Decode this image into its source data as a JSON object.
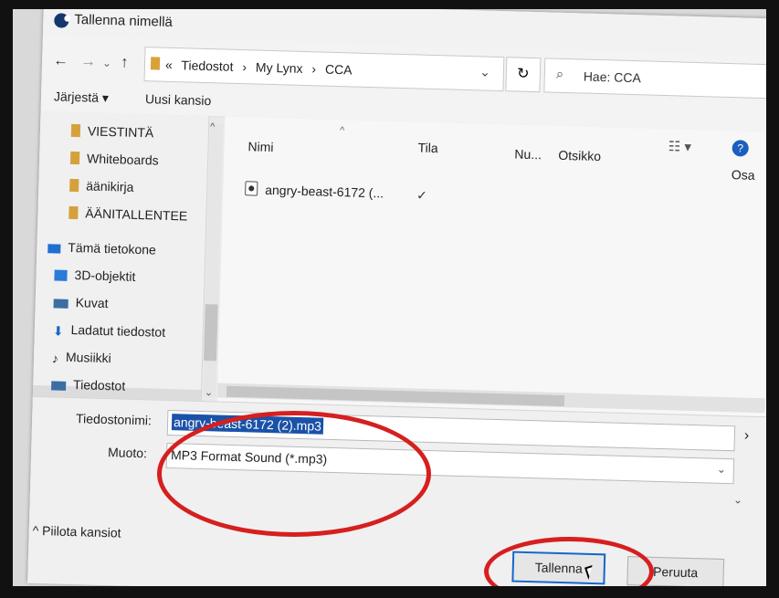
{
  "window": {
    "title": "Tallenna nimellä",
    "close": "✕"
  },
  "nav": {
    "back": "←",
    "forward": "→",
    "dropdown": "⌄",
    "up": "↑",
    "breadcrumb": [
      "«",
      "Tiedostot",
      "›",
      "My Lynx",
      "›",
      "CCA"
    ],
    "address_dropdown": "⌄",
    "refresh": "↻",
    "search_icon": "⌕",
    "search_placeholder": "Hae: CCA"
  },
  "toolbar": {
    "organize": "Järjestä ▾",
    "new_folder": "Uusi kansio"
  },
  "sidebar": {
    "items": [
      {
        "label": "VIESTINTÄ",
        "icon": "folder-icon"
      },
      {
        "label": "Whiteboards",
        "icon": "folder-icon"
      },
      {
        "label": "äänikirja",
        "icon": "folder-icon"
      },
      {
        "label": "ÄÄNITALLENTEE",
        "icon": "folder-icon"
      },
      {
        "label": "Tämä tietokone",
        "icon": "computer-icon"
      },
      {
        "label": "3D-objektit",
        "icon": "3d-objects-icon"
      },
      {
        "label": "Kuvat",
        "icon": "pictures-icon"
      },
      {
        "label": "Ladatut tiedostot",
        "icon": "download-icon"
      },
      {
        "label": "Musiikki",
        "icon": "music-icon"
      },
      {
        "label": "Tiedostot",
        "icon": "drive-icon"
      }
    ],
    "collapse_caret": "^",
    "expand_caret": "⌄"
  },
  "file_list": {
    "columns": [
      "Nimi",
      "Tila",
      "Nu...",
      "Otsikko",
      "Osa"
    ],
    "sort_caret": "^",
    "rows": [
      {
        "name": "angry-beast-6172 (...",
        "status_icon": "✓"
      }
    ],
    "view_icon": "☷ ▾",
    "help": "?"
  },
  "bottom": {
    "filename_label": "Tiedostonimi:",
    "filename_value": "angry-beast-6172 (2).mp3",
    "format_label": "Muoto:",
    "format_value": "MP3 Format Sound (*.mp3)",
    "hide_folders": "^ Piilota kansiot",
    "save": "Tallenna",
    "cancel": "Peruuta",
    "right_chevron": "›",
    "dropdown_arrow": "⌄"
  },
  "colors": {
    "annotation": "#d61f1f",
    "selection": "#1a52a8",
    "primary_border": "#1566cc"
  }
}
